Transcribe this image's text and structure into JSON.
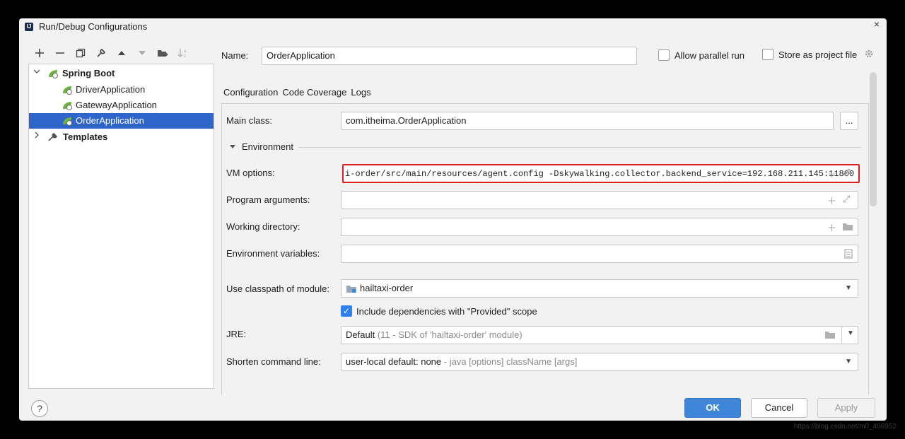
{
  "window": {
    "title": "Run/Debug Configurations"
  },
  "toolbar": {
    "buttons": [
      "+",
      "−",
      "⧉",
      "🔧",
      "▲",
      "▼",
      "📁",
      "↓"
    ]
  },
  "tree": {
    "root_label": "Spring Boot",
    "children": [
      "DriverApplication",
      "GatewayApplication",
      "OrderApplication"
    ],
    "templates_label": "Templates"
  },
  "name_row": {
    "label": "Name:",
    "value": "OrderApplication",
    "allow_parallel_label": "Allow parallel run",
    "store_label": "Store as project file"
  },
  "tabs": [
    "Configuration",
    "Code Coverage",
    "Logs"
  ],
  "form": {
    "main_class_label": "Main class:",
    "main_class_value": "com.itheima.OrderApplication",
    "browse_label": "...",
    "environment_label": "Environment",
    "vm_options_label": "VM options:",
    "vm_options_value": "i-order/src/main/resources/agent.config -Dskywalking.collector.backend_service=192.168.211.145:11800",
    "program_args_label": "Program arguments:",
    "working_dir_label": "Working directory:",
    "env_vars_label": "Environment variables:",
    "classpath_label": "Use classpath of module:",
    "classpath_value": "hailtaxi-order",
    "include_deps_label": "Include dependencies with \"Provided\" scope",
    "jre_label": "JRE:",
    "jre_value": "Default",
    "jre_hint": "(11 - SDK of 'hailtaxi-order' module)",
    "shorten_label": "Shorten command line:",
    "shorten_value": "user-local default: none",
    "shorten_hint": "- java [options] className [args]"
  },
  "footer": {
    "help_label": "?",
    "ok_label": "OK",
    "cancel_label": "Cancel",
    "apply_label": "Apply"
  },
  "watermark": "https://blog.csdn.net/m0_466952",
  "colors": {
    "selection": "#2f65ca",
    "ok_button": "#3f86d9",
    "highlight_border": "#e02020",
    "checkbox": "#2f80ed"
  }
}
